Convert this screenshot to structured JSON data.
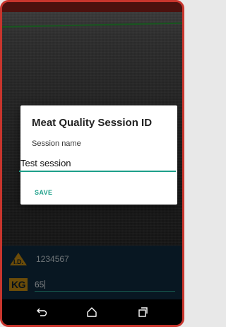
{
  "dialog": {
    "title": "Meat Quality Session ID",
    "label": "Session name",
    "input_value": "Test session",
    "save_label": "SAVE"
  },
  "bottom_panel": {
    "id_badge_text": "I.D.",
    "id_value": "1234567",
    "kg_badge_text": "KG",
    "kg_value": "65"
  },
  "colors": {
    "frame": "#c8352d",
    "accent": "#1ea08a",
    "badge": "#c48a12",
    "panel": "#0f2a3e",
    "scan_line": "#2d9e3a"
  },
  "nav": {
    "icons": [
      "back-icon",
      "home-icon",
      "recents-icon"
    ]
  }
}
